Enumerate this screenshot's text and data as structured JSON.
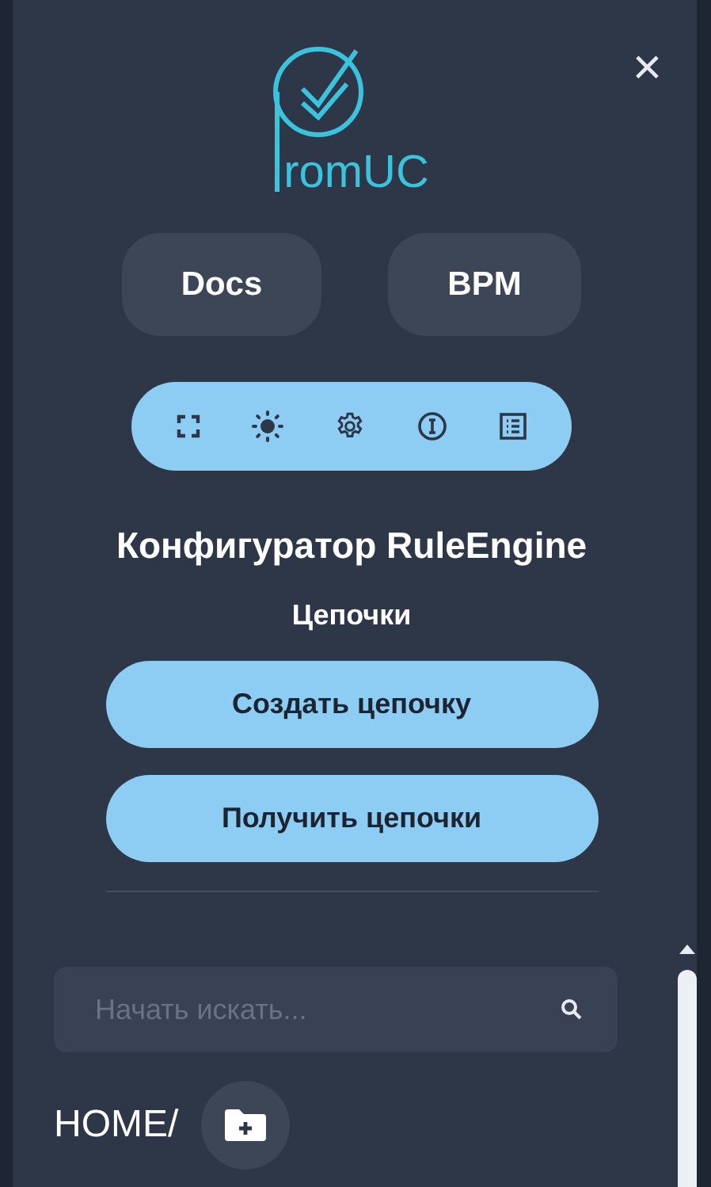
{
  "logo": {
    "text": "romUC"
  },
  "close": {
    "label": "×"
  },
  "links": [
    "Docs",
    "BPM"
  ],
  "toolbar": [
    {
      "kind": "fullscreen"
    },
    {
      "kind": "theme"
    },
    {
      "kind": "settings"
    },
    {
      "kind": "info"
    },
    {
      "kind": "list"
    }
  ],
  "title": "Конфигуратор RuleEngine",
  "section": "Цепочки",
  "actions": [
    "Создать цепочку",
    "Получить цепочки"
  ],
  "search": {
    "placeholder": "Начать искать..."
  },
  "path": {
    "label": "HOME/"
  }
}
